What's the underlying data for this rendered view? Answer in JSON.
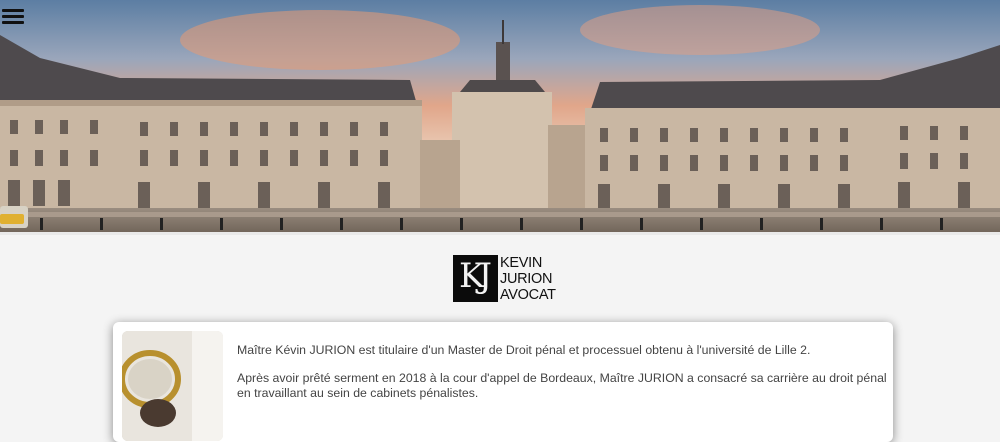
{
  "header": {
    "menu_icon": "hamburger-menu-icon",
    "banner_image": "place-de-la-bourse-panorama"
  },
  "logo": {
    "monogram": "KJ",
    "lines": [
      "KEVIN",
      "JURION",
      "AVOCAT"
    ]
  },
  "bio": {
    "portrait_image": "lawyer-portrait",
    "paragraphs": [
      "Maître Kévin JURION est titulaire d'un Master de Droit pénal et processuel obtenu à l'université de Lille 2.",
      "Après avoir prêté serment en 2018 à la cour d'appel de Bordeaux, Maître JURION a consacré sa carrière au droit pénal en travaillant au sein de cabinets pénalistes."
    ]
  }
}
